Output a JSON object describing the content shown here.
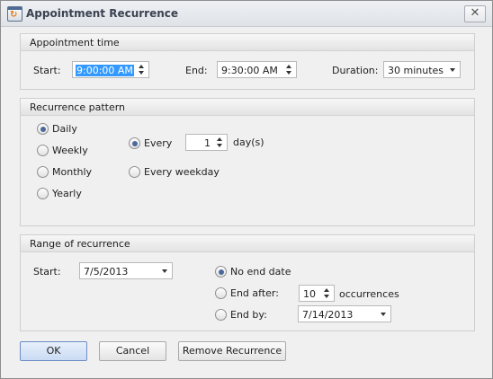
{
  "window": {
    "title": "Appointment Recurrence",
    "close_glyph": "✕",
    "icon": "app-recurrence-icon"
  },
  "appointment_time": {
    "title": "Appointment time",
    "start_label": "Start:",
    "start_value": "9:00:00 AM",
    "end_label": "End:",
    "end_value": "9:30:00 AM",
    "duration_label": "Duration:",
    "duration_value": "30 minutes"
  },
  "recurrence_pattern": {
    "title": "Recurrence pattern",
    "types": [
      {
        "label": "Daily",
        "checked": true
      },
      {
        "label": "Weekly",
        "checked": false
      },
      {
        "label": "Monthly",
        "checked": false
      },
      {
        "label": "Yearly",
        "checked": false
      }
    ],
    "every_label": "Every",
    "every_value": "1",
    "days_unit": "day(s)",
    "every_weekday_label": "Every weekday"
  },
  "range": {
    "title": "Range of recurrence",
    "start_label": "Start:",
    "start_value": "7/5/2013",
    "no_end_label": "No end date",
    "end_after_label": "End after:",
    "occurrences_value": "10",
    "occurrences_label": "occurrences",
    "end_by_label": "End by:",
    "end_by_value": "7/14/2013"
  },
  "buttons": {
    "ok": "OK",
    "cancel": "Cancel",
    "remove": "Remove Recurrence"
  }
}
